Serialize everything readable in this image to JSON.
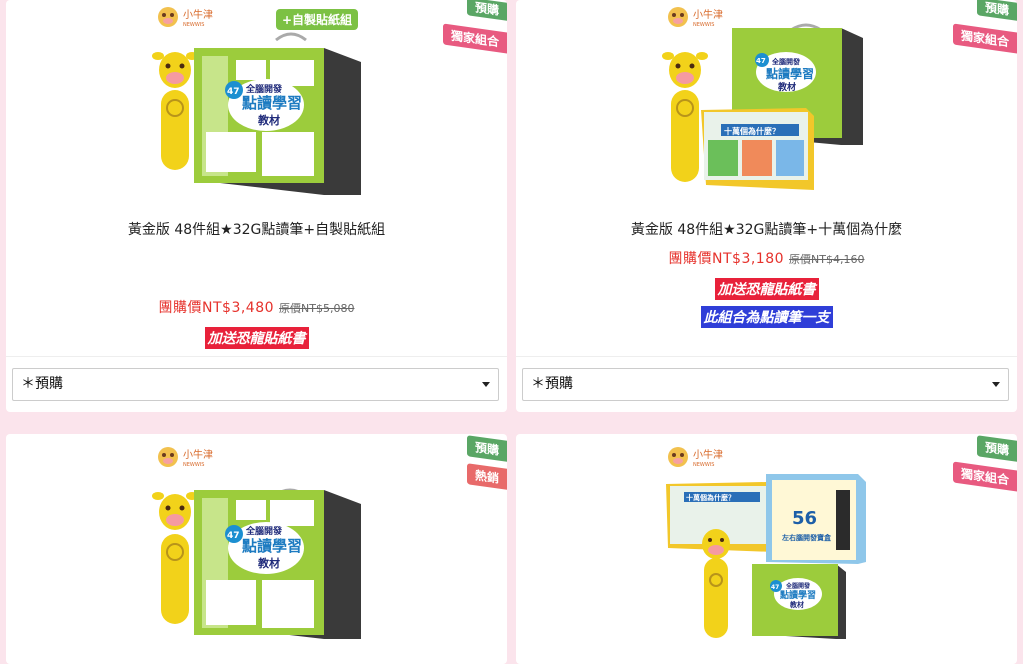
{
  "products": [
    {
      "brand_cn": "小牛津",
      "brand_en": "NEWWIS",
      "img_badge": "+自製貼紙組",
      "box_text": [
        "全腦開發",
        "點讀學習",
        "教材"
      ],
      "box_number": "47",
      "tags": [
        "預購",
        "獨家組合"
      ],
      "title": "黃金版 48件組★32G點讀筆+自製貼紙組",
      "price": "團購價NT$3,480",
      "original_price": "原價NT$5,080",
      "gifts": [
        "加送恐龍貼紙書"
      ],
      "select_value": "＊預購"
    },
    {
      "brand_cn": "小牛津",
      "brand_en": "NEWWIS",
      "box_text": [
        "全腦開發",
        "點讀學習",
        "教材"
      ],
      "box_number": "47",
      "book_title": "十萬個為什麼？",
      "tags": [
        "預購",
        "獨家組合"
      ],
      "title": "黃金版 48件組★32G點讀筆+十萬個為什麼",
      "price": "團購價NT$3,180",
      "original_price": "原價NT$4,160",
      "gifts": [
        "加送恐龍貼紙書",
        "此組合為點讀筆一支"
      ],
      "select_value": "＊預購"
    },
    {
      "brand_cn": "小牛津",
      "brand_en": "NEWWIS",
      "box_text": [
        "全腦開發",
        "點讀學習",
        "教材"
      ],
      "box_number": "47",
      "tags": [
        "預購",
        "熱銷"
      ]
    },
    {
      "brand_cn": "小牛津",
      "brand_en": "NEWWIS",
      "box_text": [
        "全腦開發",
        "點讀學習",
        "教材"
      ],
      "box_number": "47",
      "book_title": "十萬個為什麼？",
      "box2_number": "56",
      "box2_text": "左右腦開發寶盒",
      "tags": [
        "預購",
        "獨家組合"
      ]
    }
  ],
  "colors": {
    "price": "#e6322c",
    "gift_red": "#e8213a",
    "gift_blue": "#2f3ed8",
    "tag_green": "#5aa665",
    "tag_pink": "#e85a80",
    "background": "#fbe4ec"
  }
}
